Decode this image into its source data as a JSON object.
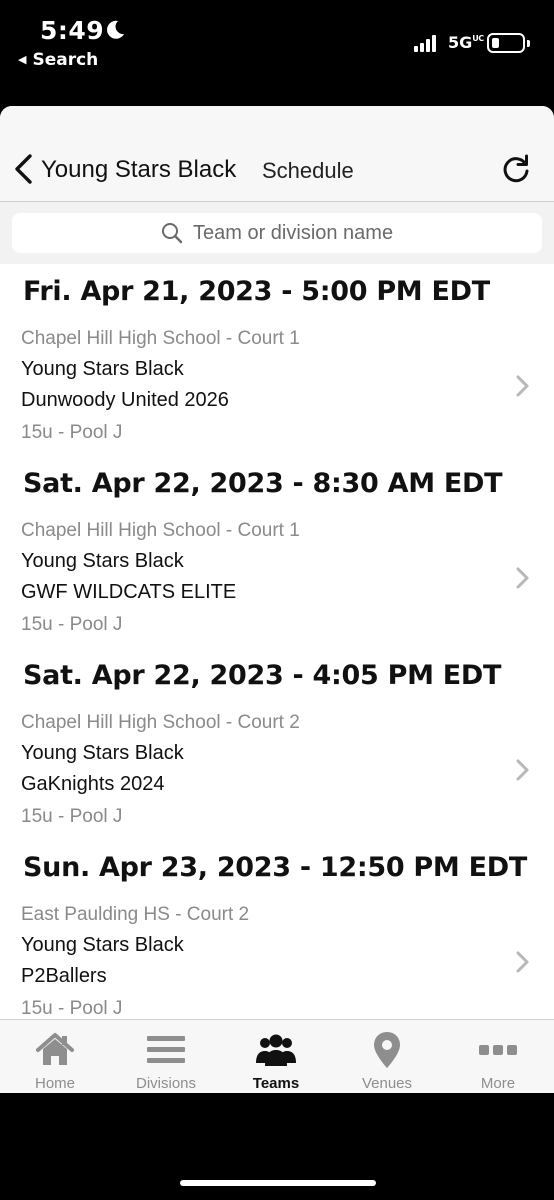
{
  "status": {
    "time": "5:49",
    "back_label": "Search",
    "network": "5G",
    "network_sup": "UC"
  },
  "nav": {
    "team": "Young Stars Black",
    "subtitle": "Schedule"
  },
  "search": {
    "placeholder": "Team or division name"
  },
  "games": [
    {
      "datetime": "Fri. Apr 21, 2023 - 5:00 PM EDT",
      "venue": "Chapel Hill High School - Court 1",
      "team1": "Young Stars Black",
      "team2": "Dunwoody United 2026",
      "division": "15u - Pool J"
    },
    {
      "datetime": "Sat. Apr 22, 2023 - 8:30 AM EDT",
      "venue": "Chapel Hill High School - Court 1",
      "team1": "Young Stars Black",
      "team2": "GWF WILDCATS ELITE",
      "division": "15u - Pool J"
    },
    {
      "datetime": "Sat. Apr 22, 2023 - 4:05 PM EDT",
      "venue": "Chapel Hill High School - Court 2",
      "team1": "Young Stars Black",
      "team2": "GaKnights 2024",
      "division": "15u - Pool J"
    },
    {
      "datetime": "Sun. Apr 23, 2023 - 12:50 PM EDT",
      "venue": "East Paulding HS - Court 2",
      "team1": "Young Stars Black",
      "team2": "P2Ballers",
      "division": "15u - Pool J"
    }
  ],
  "tabs": [
    {
      "label": "Home",
      "icon": "home-icon",
      "active": false
    },
    {
      "label": "Divisions",
      "icon": "divisions-icon",
      "active": false
    },
    {
      "label": "Teams",
      "icon": "teams-icon",
      "active": true
    },
    {
      "label": "Venues",
      "icon": "venues-icon",
      "active": false
    },
    {
      "label": "More",
      "icon": "more-icon",
      "active": false
    }
  ],
  "colors": {
    "inactive_tab": "#8e8e8e",
    "active_tab": "#111111",
    "muted_text": "#8a8a8a"
  }
}
